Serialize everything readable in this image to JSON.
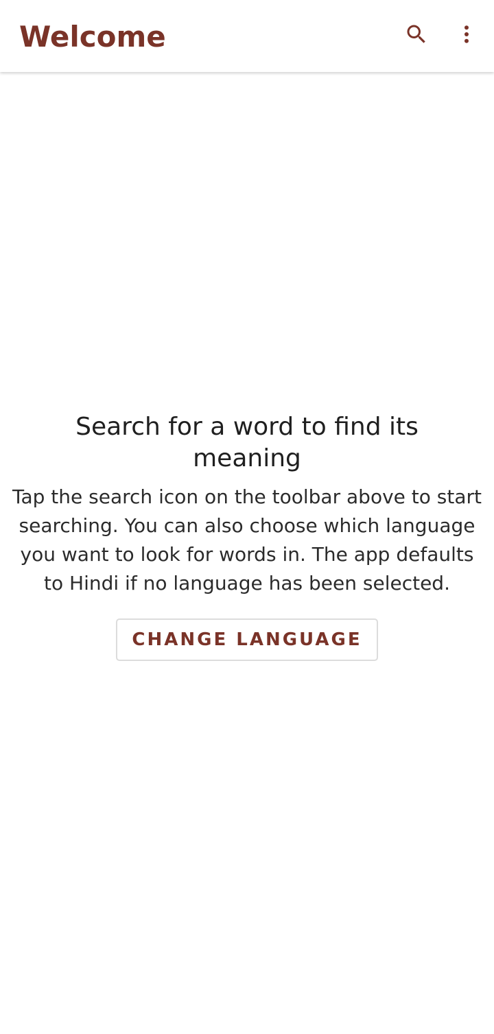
{
  "toolbar": {
    "title": "Welcome",
    "search_icon": "search-icon",
    "more_icon": "more-vert-icon"
  },
  "empty_state": {
    "headline": "Search for a word to find its meaning",
    "body": "Tap the search icon on the toolbar above to start searching. You can also choose which language you want to look for words in. The app defaults to Hindi if no language has been selected.",
    "button_label": "CHANGE LANGUAGE"
  },
  "colors": {
    "accent": "#7a3328",
    "text_primary": "#1f1f1f",
    "background": "#ffffff"
  }
}
